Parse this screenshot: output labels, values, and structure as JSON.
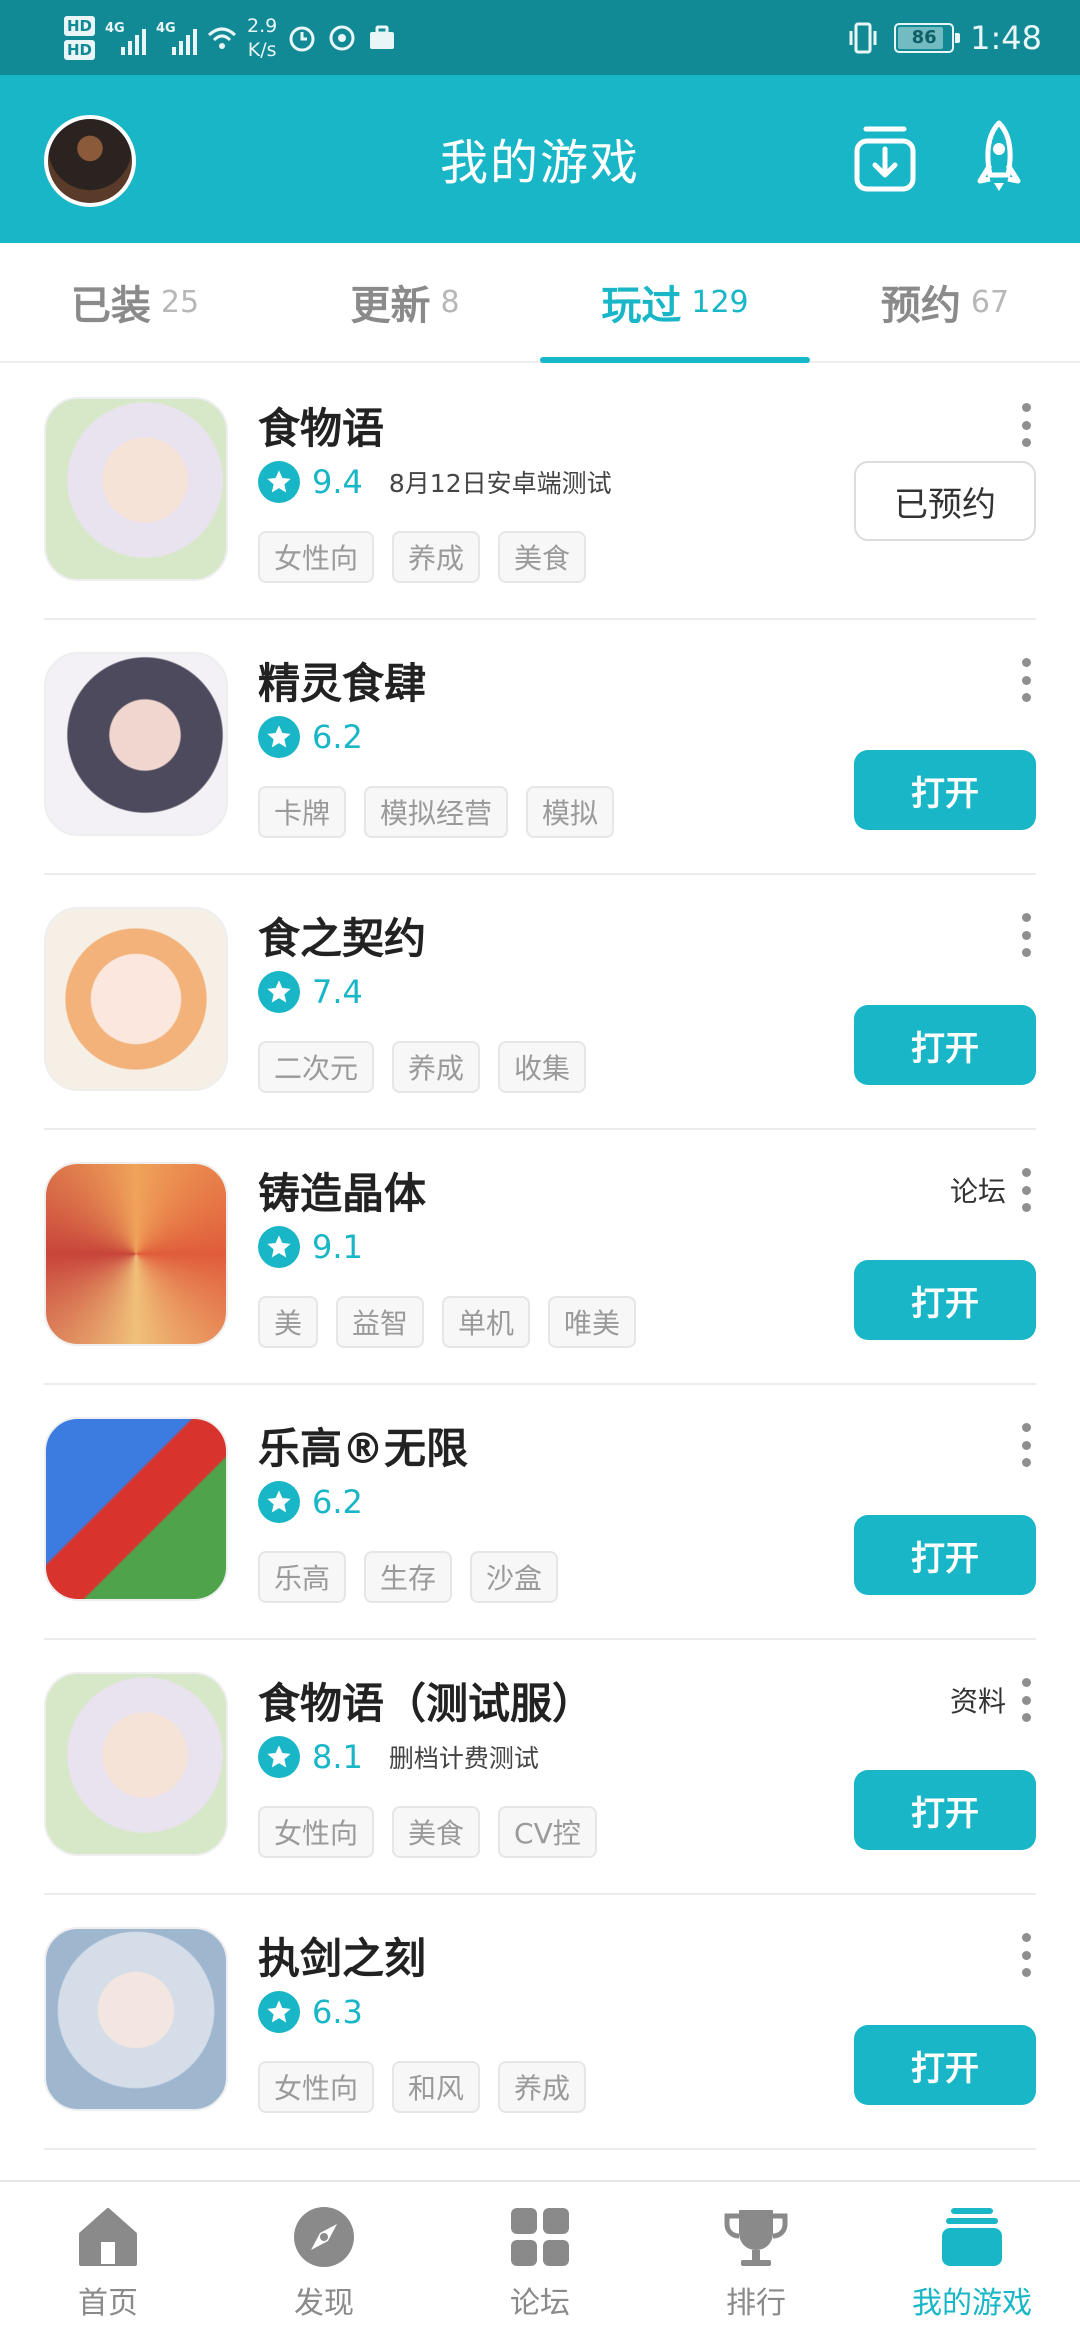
{
  "status_bar": {
    "hd_top": "HD",
    "hd_bottom": "HD",
    "net1": "4G",
    "net2": "4G",
    "speed_value": "2.9",
    "speed_unit": "K/s",
    "battery": "86",
    "time": "1:48"
  },
  "header": {
    "title": "我的游戏"
  },
  "tabs": [
    {
      "label": "已装",
      "count": "25"
    },
    {
      "label": "更新",
      "count": "8"
    },
    {
      "label": "玩过",
      "count": "129"
    },
    {
      "label": "预约",
      "count": "67"
    }
  ],
  "games": [
    {
      "name": "食物语",
      "score": "9.4",
      "note": "8月12日安卓端测试",
      "tags": [
        "女性向",
        "养成",
        "美食"
      ],
      "side_link": "",
      "action": "已预约"
    },
    {
      "name": "精灵食肆",
      "score": "6.2",
      "note": "",
      "tags": [
        "卡牌",
        "模拟经营",
        "模拟"
      ],
      "side_link": "",
      "action": "打开"
    },
    {
      "name": "食之契约",
      "score": "7.4",
      "note": "",
      "tags": [
        "二次元",
        "养成",
        "收集"
      ],
      "side_link": "",
      "action": "打开"
    },
    {
      "name": "铸造晶体",
      "score": "9.1",
      "note": "",
      "tags": [
        "美",
        "益智",
        "单机",
        "唯美"
      ],
      "side_link": "论坛",
      "action": "打开"
    },
    {
      "name": "乐高®无限",
      "score": "6.2",
      "note": "",
      "tags": [
        "乐高",
        "生存",
        "沙盒"
      ],
      "side_link": "",
      "action": "打开"
    },
    {
      "name": "食物语（测试服）",
      "score": "8.1",
      "note": "删档计费测试",
      "tags": [
        "女性向",
        "美食",
        "CV控"
      ],
      "side_link": "资料",
      "action": "打开"
    },
    {
      "name": "执剑之刻",
      "score": "6.3",
      "note": "",
      "tags": [
        "女性向",
        "和风",
        "养成"
      ],
      "side_link": "",
      "action": "打开"
    }
  ],
  "bottom_nav": [
    {
      "label": "首页",
      "icon": "home-icon"
    },
    {
      "label": "发现",
      "icon": "compass-icon"
    },
    {
      "label": "论坛",
      "icon": "grid-icon"
    },
    {
      "label": "排行",
      "icon": "trophy-icon"
    },
    {
      "label": "我的游戏",
      "icon": "stack-icon"
    }
  ],
  "colors": {
    "accent": "#18b6c6",
    "status_bar": "#128a96",
    "inactive": "#8a8a8a"
  }
}
